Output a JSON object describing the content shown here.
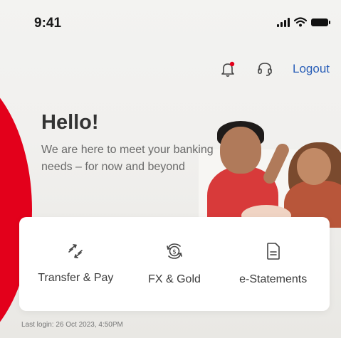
{
  "status_bar": {
    "time": "9:41"
  },
  "header": {
    "logout_label": "Logout"
  },
  "greeting": {
    "title": "Hello!",
    "subtitle": "We are here to meet your banking needs – for now and beyond"
  },
  "quick_actions": [
    {
      "label": "Transfer & Pay",
      "icon": "transfer-arrows-icon"
    },
    {
      "label": "FX & Gold",
      "icon": "fx-exchange-icon"
    },
    {
      "label": "e-Statements",
      "icon": "document-icon"
    }
  ],
  "last_login": "Last login: 26 Oct 2023, 4:50PM",
  "colors": {
    "brand_red": "#e3001b",
    "link_blue": "#2a5fb8"
  }
}
